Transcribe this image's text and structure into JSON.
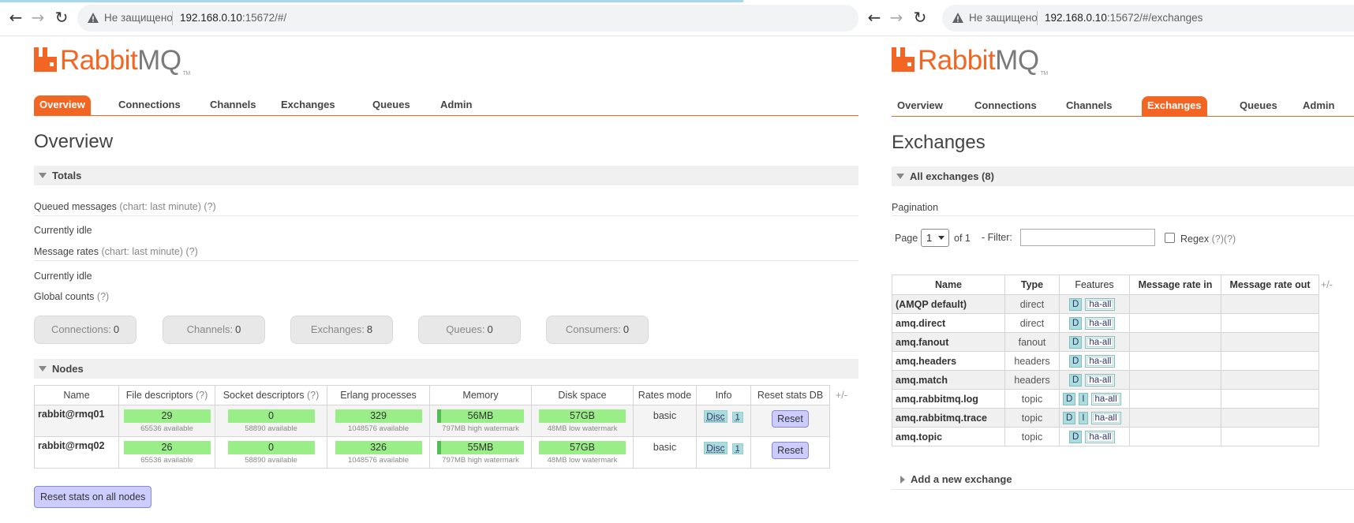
{
  "left": {
    "browser": {
      "security_label": "Не защищено",
      "url_host": "192.168.0.10",
      "url_rest": ":15672/#/"
    },
    "logo": {
      "brand_main": "Rabbit",
      "brand_mq": "MQ",
      "tm": "TM"
    },
    "tabs": [
      "Overview",
      "Connections",
      "Channels",
      "Exchanges",
      "Queues",
      "Admin"
    ],
    "active_tab": "Overview",
    "title": "Overview",
    "totals": {
      "header": "Totals",
      "queued_label": "Queued messages",
      "queued_hint": "(chart: last minute)",
      "help": "(?)",
      "idle1": "Currently idle",
      "rates_label": "Message rates",
      "rates_hint": "(chart: last minute)",
      "idle2": "Currently idle",
      "global_label": "Global counts",
      "counts": [
        {
          "label": "Connections:",
          "value": "0"
        },
        {
          "label": "Channels:",
          "value": "0"
        },
        {
          "label": "Exchanges:",
          "value": "8"
        },
        {
          "label": "Queues:",
          "value": "0"
        },
        {
          "label": "Consumers:",
          "value": "0"
        }
      ]
    },
    "nodes": {
      "header": "Nodes",
      "columns": {
        "name": "Name",
        "file_desc": "File descriptors",
        "socket_desc": "Socket descriptors",
        "erlang": "Erlang processes",
        "memory": "Memory",
        "disk": "Disk space",
        "rates_mode": "Rates mode",
        "info": "Info",
        "reset": "Reset stats DB",
        "help": "(?)"
      },
      "plus_minus": "+/-",
      "rows": [
        {
          "name": "rabbit@rmq01",
          "fd": "29",
          "fd_sub": "65536 available",
          "sd": "0",
          "sd_sub": "58890 available",
          "ep": "329",
          "ep_sub": "1048576 available",
          "mem": "56MB",
          "mem_sub": "797MB high watermark",
          "disk": "57GB",
          "disk_sub": "48MB low watermark",
          "rates_mode": "basic",
          "info_disc": "Disc",
          "info_num": "1",
          "reset": "Reset"
        },
        {
          "name": "rabbit@rmq02",
          "fd": "26",
          "fd_sub": "65536 available",
          "sd": "0",
          "sd_sub": "58890 available",
          "ep": "326",
          "ep_sub": "1048576 available",
          "mem": "55MB",
          "mem_sub": "797MB high watermark",
          "disk": "57GB",
          "disk_sub": "48MB low watermark",
          "rates_mode": "basic",
          "info_disc": "Disc",
          "info_num": "1",
          "reset": "Reset"
        }
      ],
      "reset_all": "Reset stats on all nodes"
    }
  },
  "right": {
    "browser": {
      "security_label": "Не защищено",
      "url_host": "192.168.0.10",
      "url_rest": ":15672/#/exchanges"
    },
    "logo": {
      "brand_main": "Rabbit",
      "brand_mq": "MQ",
      "tm": "TM"
    },
    "tabs": [
      "Overview",
      "Connections",
      "Channels",
      "Exchanges",
      "Queues",
      "Admin"
    ],
    "active_tab": "Exchanges",
    "title": "Exchanges",
    "all_header": "All exchanges (8)",
    "pagination": {
      "label": "Pagination",
      "page_label": "Page",
      "page_value": "1",
      "of_label": "of 1",
      "filter_label": "- Filter:",
      "filter_value": "",
      "regex_label": "Regex",
      "regex_help": "(?)(?)"
    },
    "columns": {
      "name": "Name",
      "type": "Type",
      "features": "Features",
      "rate_in": "Message rate in",
      "rate_out": "Message rate out"
    },
    "plus_minus": "+/-",
    "exchanges": [
      {
        "name": "(AMQP default)",
        "type": "direct",
        "features": [
          "D"
        ],
        "policy": "ha-all"
      },
      {
        "name": "amq.direct",
        "type": "direct",
        "features": [
          "D"
        ],
        "policy": "ha-all"
      },
      {
        "name": "amq.fanout",
        "type": "fanout",
        "features": [
          "D"
        ],
        "policy": "ha-all"
      },
      {
        "name": "amq.headers",
        "type": "headers",
        "features": [
          "D"
        ],
        "policy": "ha-all"
      },
      {
        "name": "amq.match",
        "type": "headers",
        "features": [
          "D"
        ],
        "policy": "ha-all"
      },
      {
        "name": "amq.rabbitmq.log",
        "type": "topic",
        "features": [
          "D",
          "I"
        ],
        "policy": "ha-all"
      },
      {
        "name": "amq.rabbitmq.trace",
        "type": "topic",
        "features": [
          "D",
          "I"
        ],
        "policy": "ha-all"
      },
      {
        "name": "amq.topic",
        "type": "topic",
        "features": [
          "D"
        ],
        "policy": "ha-all"
      }
    ],
    "add_new": "Add a new exchange"
  }
}
